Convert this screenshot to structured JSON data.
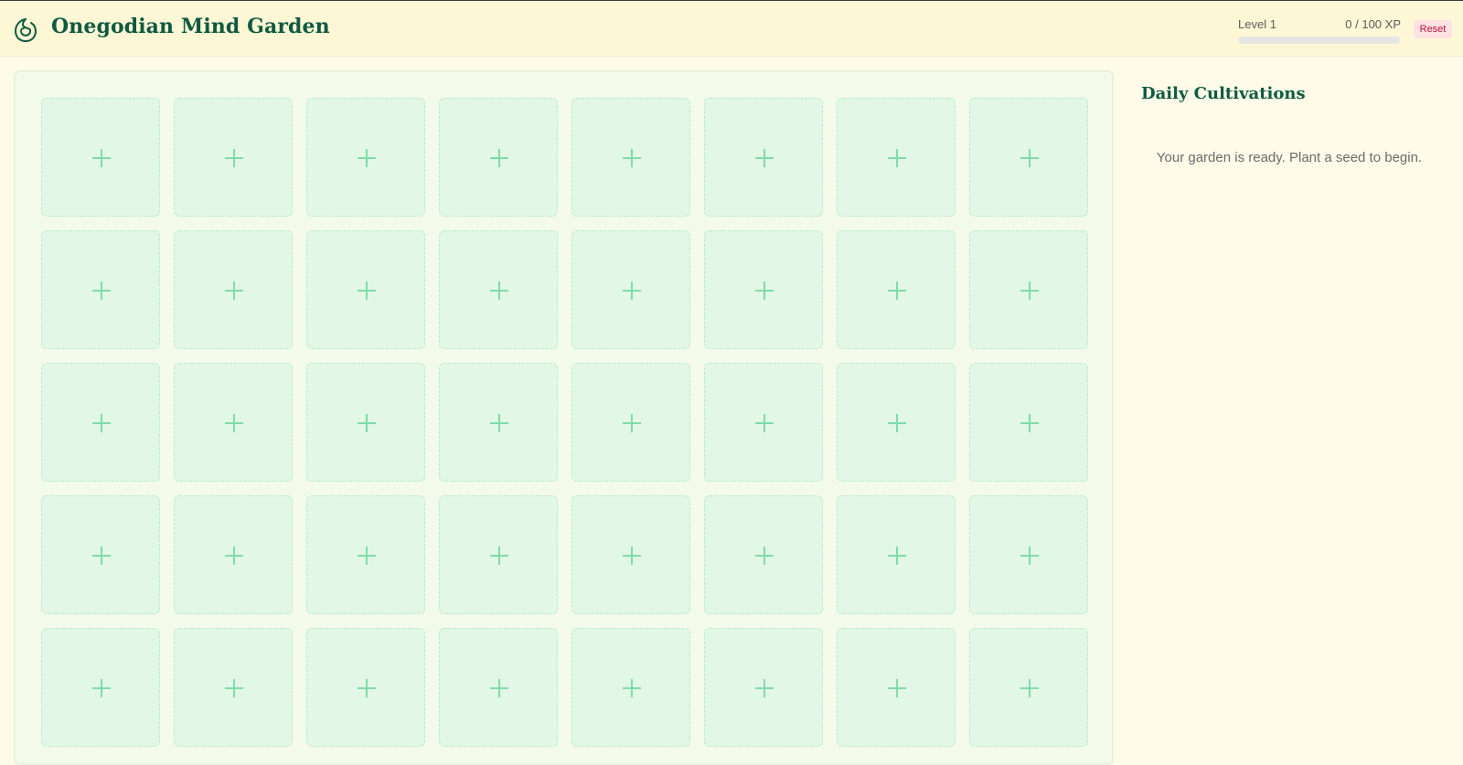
{
  "header": {
    "title": "Onegodian Mind Garden",
    "logo_icon": "sprout-swirl-icon",
    "level_label": "Level 1",
    "xp_label": "0 / 100 XP",
    "xp_progress": 0,
    "reset_label": "Reset"
  },
  "garden": {
    "rows": 5,
    "columns": 8,
    "plot_icon": "plus-icon",
    "plot_state": "empty"
  },
  "sidebar": {
    "title": "Daily Cultivations",
    "empty_message": "Your garden is ready. Plant a seed to begin."
  },
  "colors": {
    "brand": "#0f5a41",
    "plot_fill": "#e2f7e6",
    "plus": "#7fdca8",
    "reset_bg": "#fde2e4",
    "reset_text": "#be123c",
    "header_bg": "#fef7d6"
  }
}
